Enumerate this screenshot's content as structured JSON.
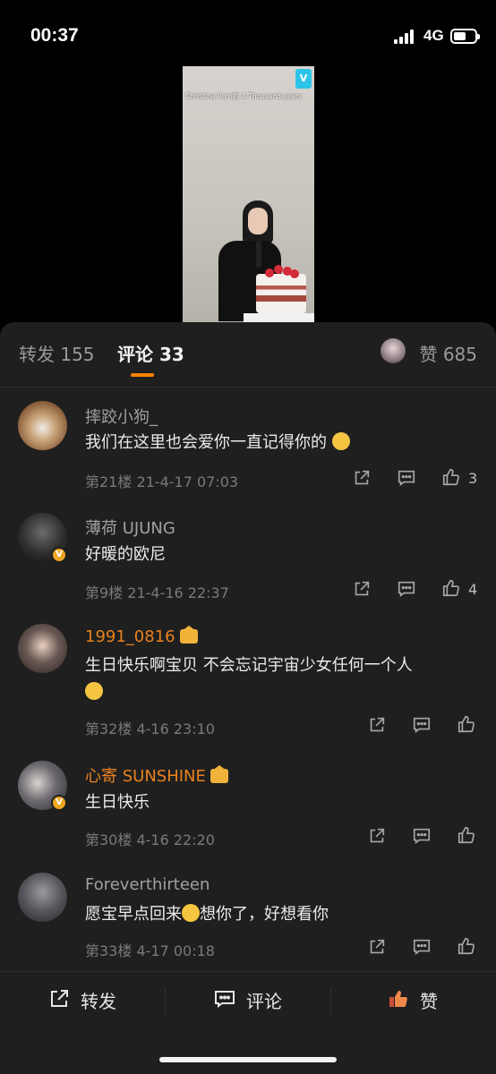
{
  "status_bar": {
    "time": "00:37",
    "network": "4G",
    "battery_level": 0.6
  },
  "video": {
    "caption": "Christina Perri的 A Thousand years",
    "logo": "V"
  },
  "tabs": {
    "repost": "转发 155",
    "comments": "评论 33",
    "likes": "赞 685"
  },
  "comments": [
    {
      "name": "摔跤小狗_",
      "text": "我们在这里也会爱你一直记得你的",
      "emoji": "rolling-eyes",
      "meta": "第21楼 21-4-17 07:03",
      "likes": "3",
      "verified": false,
      "member": false
    },
    {
      "name": "薄荷 UJUNG",
      "text": "好暖的欧尼",
      "meta": "第9楼 21-4-16 22:37",
      "likes": "4",
      "verified": true,
      "member": false
    },
    {
      "name": "1991_0816",
      "text": "生日快乐啊宝贝 不会忘记宇宙少女任何一个人",
      "emoji": "crying",
      "meta": "第32楼 4-16 23:10",
      "likes": "",
      "verified": false,
      "member": true
    },
    {
      "name": "心寄 SUNSHINE",
      "text": "生日快乐",
      "meta": "第30楼 4-16 22:20",
      "likes": "",
      "verified": true,
      "member": true
    },
    {
      "name": "Foreverthirteen",
      "text_before": "愿宝早点回来",
      "text_after": "想你了，好想看你",
      "emoji": "rolling-eyes",
      "meta": "第33楼 4-17 00:18",
      "likes": "",
      "verified": false,
      "member": false
    }
  ],
  "verified_badge": "V",
  "bottom_bar": {
    "repost": "转发",
    "comment": "评论",
    "like": "赞"
  },
  "colors": {
    "accent": "#ff8200",
    "member_name": "#e8821f",
    "sheet_bg": "#1f1f1f"
  }
}
